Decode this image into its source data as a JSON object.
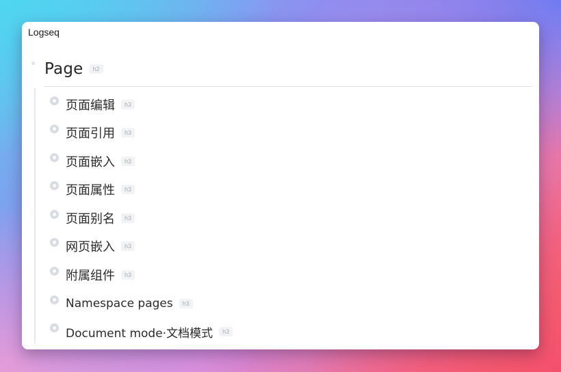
{
  "app": {
    "title": "Logseq"
  },
  "page": {
    "heading": "Page",
    "heading_tag": "h2",
    "children": [
      {
        "label": "页面编辑",
        "tag": "h3"
      },
      {
        "label": "页面引用",
        "tag": "h3"
      },
      {
        "label": "页面嵌入",
        "tag": "h3"
      },
      {
        "label": "页面属性",
        "tag": "h3"
      },
      {
        "label": "页面别名",
        "tag": "h3"
      },
      {
        "label": "网页嵌入",
        "tag": "h3"
      },
      {
        "label": "附属组件",
        "tag": "h3"
      },
      {
        "label": "Namespace pages",
        "tag": "h3"
      },
      {
        "label": "Document mode·文档模式",
        "tag": "h3"
      }
    ]
  },
  "icons": {
    "block_bullet": "bullet-dot-icon",
    "child_bullet": "ring-bullet-icon"
  },
  "colors": {
    "window_bg": "#ffffff",
    "text": "#2b2b2b",
    "bullet": "#d9dce3",
    "tag_bg": "#f2f3f5",
    "tag_text": "#a7adb6"
  }
}
